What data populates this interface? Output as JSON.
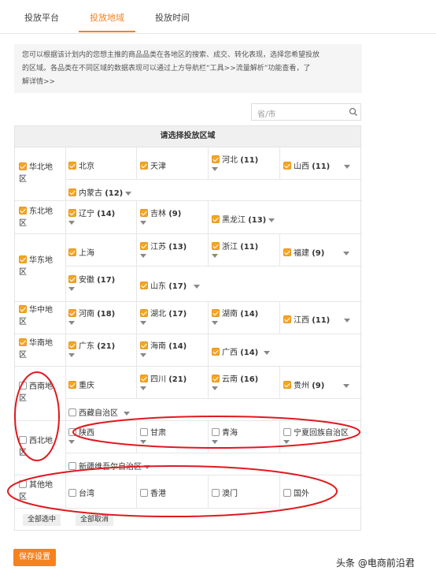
{
  "tabs": [
    {
      "label": "投放平台"
    },
    {
      "label": "投放地域"
    },
    {
      "label": "投放时间"
    }
  ],
  "description": {
    "line1": "您可以根据该计划内的您想主推的商品品类在各地区的搜索、成交、转化表现，选择您希望投放",
    "line2": "的区域。各品类在不同区域的数据表现可以通过上方导航栏“工具>>流量解析”功能查看，了",
    "line3": "解详情>>"
  },
  "search": {
    "placeholder": "省/市"
  },
  "table": {
    "header": "请选择投放区域"
  },
  "regions": {
    "huabei": {
      "line1": "华北地",
      "line2": "区"
    },
    "dongbei": {
      "line1": "东北地",
      "line2": "区"
    },
    "huadong": {
      "line1": "华东地",
      "line2": "区"
    },
    "huazhong": {
      "line1": "华中地",
      "line2": "区"
    },
    "huanan": {
      "line1": "华南地",
      "line2": "区"
    },
    "xinan": {
      "line1": "西南地",
      "line2": "区"
    },
    "xibei": {
      "line1": "西北地",
      "line2": "区"
    },
    "qita": {
      "line1": "其他地",
      "line2": "区"
    }
  },
  "provinces": {
    "beijing": "北京",
    "tianjin": "天津",
    "hebei": "河北",
    "hebei_count": "(11)",
    "shanxi": "山西",
    "shanxi_count": "(11)",
    "neimenggu": "内蒙古",
    "neimenggu_count": "(12)",
    "liaoning": "辽宁",
    "liaoning_count": "(14)",
    "jilin": "吉林",
    "jilin_count": "(9)",
    "heilongjiang": "黑龙江",
    "heilongjiang_count": "(13)",
    "shanghai": "上海",
    "jiangsu": "江苏",
    "jiangsu_count": "(13)",
    "zhejiang": "浙江",
    "zhejiang_count": "(11)",
    "fujian": "福建",
    "fujian_count": "(9)",
    "anhui": "安徽",
    "anhui_count": "(17)",
    "shandong": "山东",
    "shandong_count": "(17)",
    "henan": "河南",
    "henan_count": "(18)",
    "hubei": "湖北",
    "hubei_count": "(17)",
    "hunan": "湖南",
    "hunan_count": "(14)",
    "jiangxi": "江西",
    "jiangxi_count": "(11)",
    "guangdong": "广东",
    "guangdong_count": "(21)",
    "hainan": "海南",
    "hainan_count": "(14)",
    "guangxi": "广西",
    "guangxi_count": "(14)",
    "chongqing": "重庆",
    "sichuan": "四川",
    "sichuan_count": "(21)",
    "yunnan": "云南",
    "yunnan_count": "(16)",
    "guizhou": "贵州",
    "guizhou_count": "(9)",
    "xizang": "西藏自治区",
    "shaanxi": "陕西",
    "gansu": "甘肃",
    "qinghai": "青海",
    "ningxia": "宁夏回族自治区",
    "xinjiang": "新疆维吾尔自治区",
    "taiwan": "台湾",
    "xianggang": "香港",
    "aomen": "澳门",
    "guowai": "国外"
  },
  "footer": {
    "select_all": "全部选中",
    "cancel_all": "全部取消"
  },
  "save_button": "保存设置",
  "watermark": "头条 @电商前沿君",
  "colors": {
    "accent": "#f58220",
    "checkbox": "#f5a623",
    "annotation": "#e0191f"
  }
}
